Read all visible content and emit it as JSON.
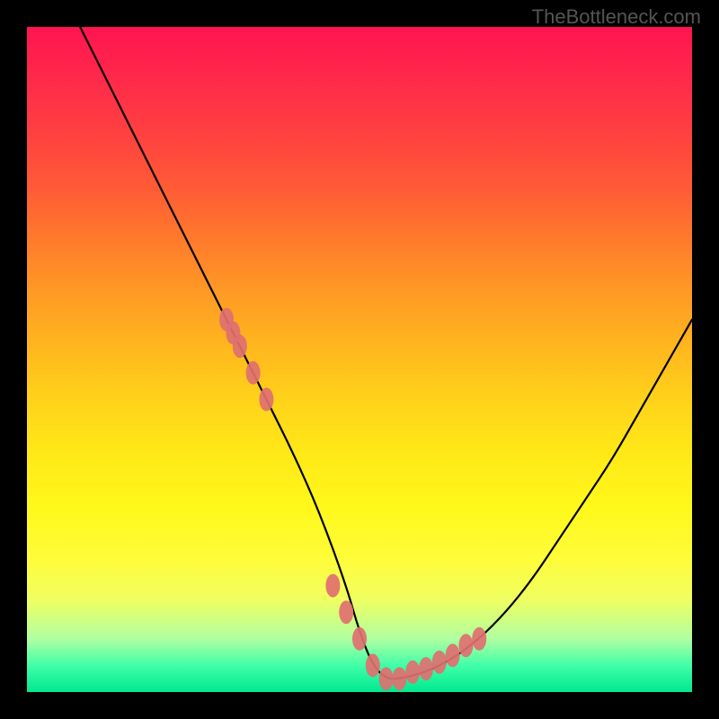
{
  "watermark": "TheBottleneck.com",
  "chart_data": {
    "type": "line",
    "title": "",
    "xlabel": "",
    "ylabel": "",
    "xlim": [
      0,
      100
    ],
    "ylim": [
      0,
      100
    ],
    "grid": false,
    "legend": false,
    "series": [
      {
        "name": "bottleneck-curve",
        "x": [
          8,
          12,
          16,
          20,
          24,
          28,
          32,
          36,
          40,
          44,
          48,
          50,
          52,
          54,
          56,
          60,
          64,
          68,
          72,
          76,
          80,
          84,
          88,
          92,
          96,
          100
        ],
        "values": [
          100,
          92,
          84,
          76,
          68,
          60,
          52,
          44,
          36,
          27,
          16,
          9,
          4,
          2,
          2,
          3,
          5,
          8,
          12,
          17,
          23,
          29,
          35,
          42,
          49,
          56
        ]
      }
    ],
    "markers": {
      "name": "highlight-points",
      "color": "#e07070",
      "x": [
        30,
        31,
        32,
        34,
        36,
        46,
        48,
        50,
        52,
        54,
        56,
        58,
        60,
        62,
        64,
        66,
        68
      ],
      "values": [
        56,
        54,
        52,
        48,
        44,
        16,
        12,
        8,
        4,
        2,
        2,
        3,
        3.5,
        4.5,
        5.5,
        7,
        8
      ]
    }
  }
}
